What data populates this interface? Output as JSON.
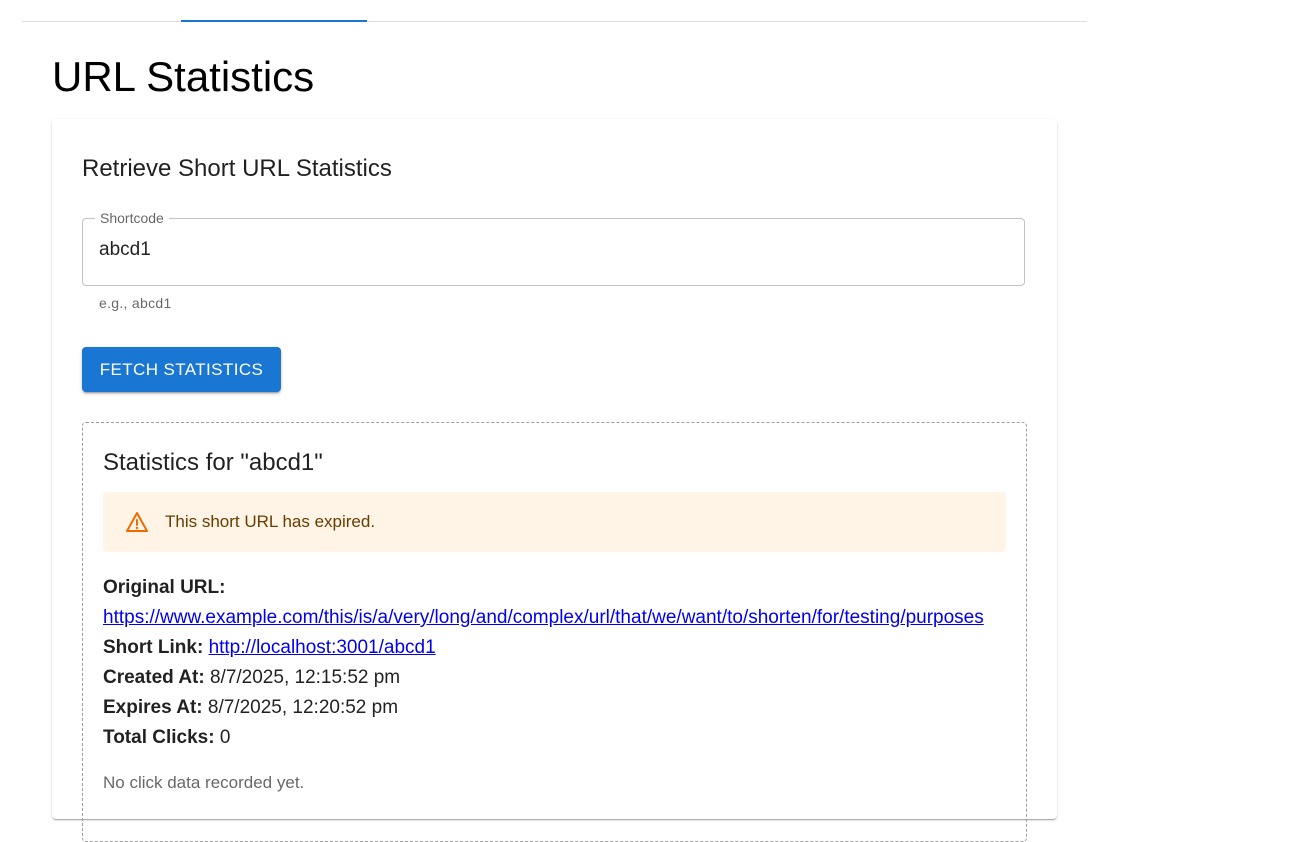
{
  "page": {
    "title": "URL Statistics"
  },
  "card": {
    "heading": "Retrieve Short URL Statistics",
    "shortcode_field": {
      "label": "Shortcode",
      "value": "abcd1",
      "helper": "e.g., abcd1"
    },
    "fetch_button_label": "FETCH STATISTICS"
  },
  "results": {
    "heading": "Statistics for \"abcd1\"",
    "alert": {
      "icon": "warning-icon",
      "text": "This short URL has expired.",
      "color": "#ed6c02"
    },
    "original_url_label": "Original URL:",
    "original_url": "https://www.example.com/this/is/a/very/long/and/complex/url/that/we/want/to/shorten/for/testing/purposes",
    "short_link_label": "Short Link:",
    "short_link": "http://localhost:3001/abcd1",
    "created_at_label": "Created At:",
    "created_at": "8/7/2025, 12:15:52 pm",
    "expires_at_label": "Expires At:",
    "expires_at": "8/7/2025, 12:20:52 pm",
    "total_clicks_label": "Total Clicks:",
    "total_clicks": "0",
    "empty_note": "No click data recorded yet."
  },
  "colors": {
    "primary": "#1976d2",
    "alert_background": "#fff4e5",
    "alert_text": "#663c00",
    "link": "#0000ee"
  }
}
